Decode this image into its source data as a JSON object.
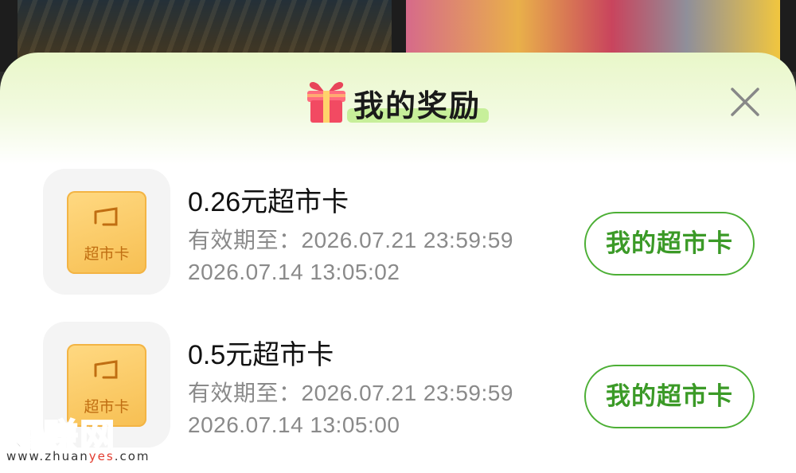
{
  "header": {
    "title": "我的奖励"
  },
  "rewards": [
    {
      "name": "0.26元超市卡",
      "expiry": "有效期至：2026.07.21 23:59:59",
      "time": "2026.07.14 13:05:02",
      "icon_label": "超市卡",
      "button_label": "我的超市卡"
    },
    {
      "name": "0.5元超市卡",
      "expiry": "有效期至：2026.07.21 23:59:59",
      "time": "2026.07.14 13:05:00",
      "icon_label": "超市卡",
      "button_label": "我的超市卡"
    }
  ],
  "watermark": {
    "logo_text": "好赚网",
    "url_prefix": "www.zhuan",
    "url_highlight": "yes",
    "url_suffix": ".com"
  },
  "colors": {
    "accent_green": "#3b9a27",
    "card_gold": "#f7bf52",
    "header_tint": "#e9f7c9"
  },
  "icons": [
    "gift-icon",
    "close-icon",
    "supermarket-card-icon"
  ]
}
